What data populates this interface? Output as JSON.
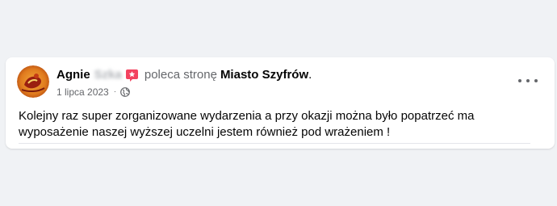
{
  "post": {
    "author_first_name": "Agnie",
    "author_blurred_name": "Szka",
    "action_text": "poleca stronę",
    "page_name": "Miasto Szyfrów",
    "period": ".",
    "date": "1 lipca 2023",
    "separator": "·",
    "audience_icon": "globe-icon",
    "badge_icon": "recommend-star-icon",
    "more_icon": "more-options-icon",
    "text": "Kolejny raz super zorganizowane wydarzenia a przy okazji można  było popatrzeć ma\nwyposażenie naszej wyższej uczelni jestem również  pod  wrażeniem !"
  },
  "colors": {
    "background": "#f0f2f5",
    "card": "#ffffff",
    "primary_text": "#050505",
    "secondary_text": "#65676b",
    "badge": "#f3425f"
  }
}
